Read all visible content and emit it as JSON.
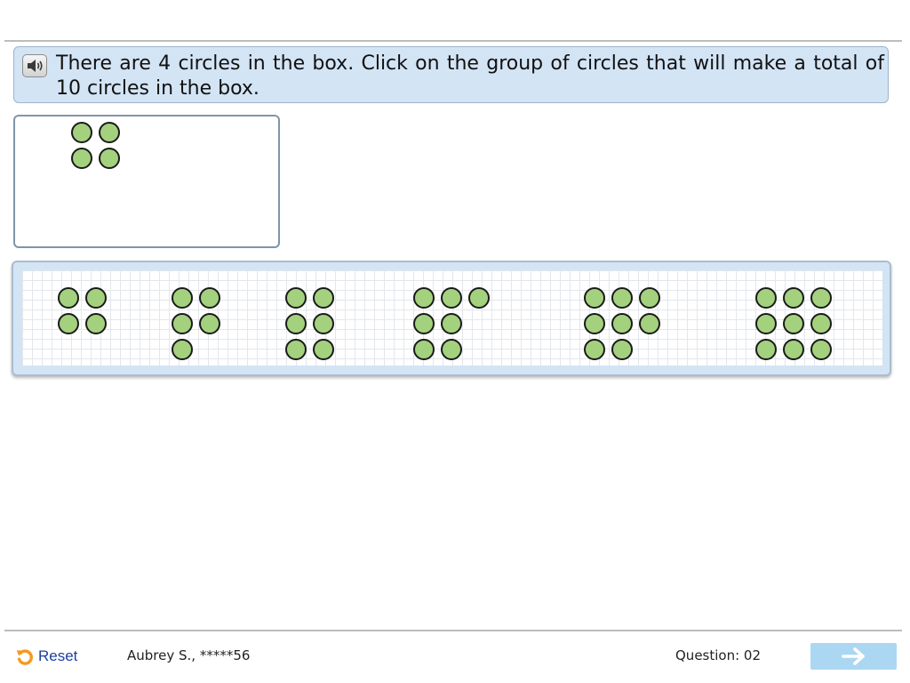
{
  "question": {
    "text": "There are 4 circles in the box. Click on the group of circles that will make a total of 10 circles in the box.",
    "speaker_icon": "speaker-icon"
  },
  "target_box": {
    "circle_count": 4
  },
  "answer_options": [
    {
      "circle_count": 4
    },
    {
      "circle_count": 5
    },
    {
      "circle_count": 6
    },
    {
      "circle_count": 7
    },
    {
      "circle_count": 8
    },
    {
      "circle_count": 9
    }
  ],
  "footer": {
    "reset_label": "Reset",
    "reset_icon": "reset-icon",
    "student": "Aubrey S., *****56",
    "question_number": "Question: 02",
    "next_icon": "arrow-right-icon"
  },
  "colors": {
    "circle_fill": "#a4d17e",
    "circle_stroke": "#1a1a1a",
    "panel_background": "#d3e4f5",
    "reset_icon": "#f39a1f",
    "reset_label": "#1d3f9e",
    "next_button": "#abd7f3"
  }
}
